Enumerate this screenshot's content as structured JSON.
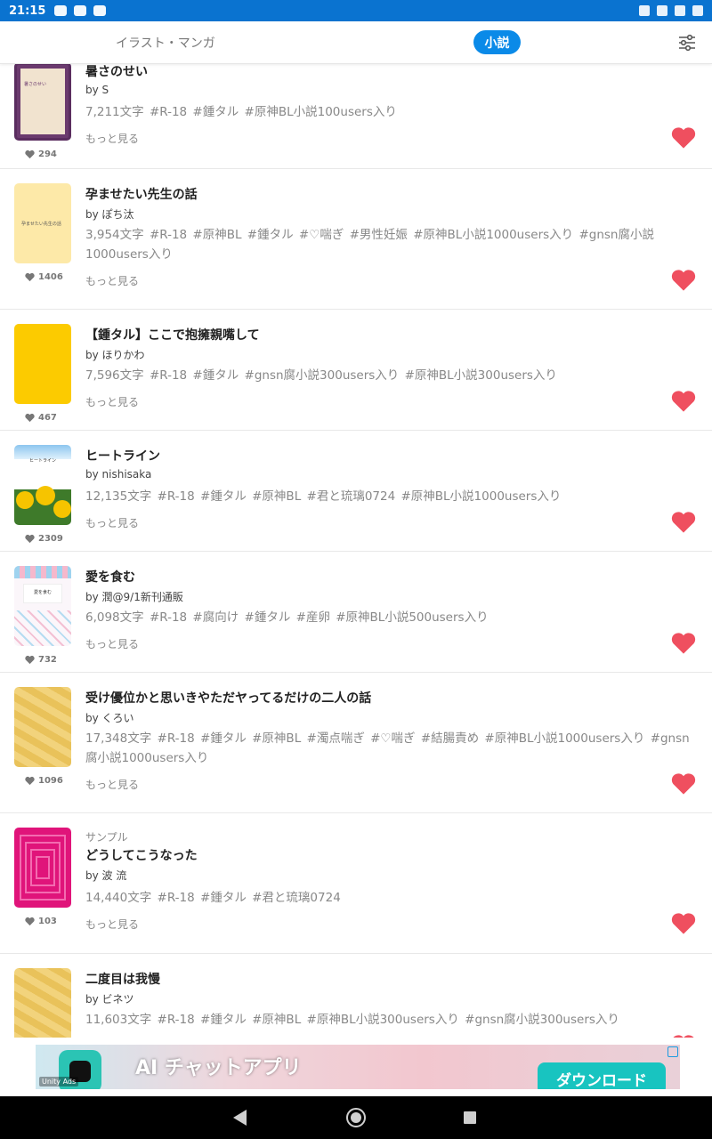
{
  "status_bar": {
    "time": "21:15"
  },
  "tabs": {
    "illust_manga": "イラスト・マンガ",
    "novel": "小説"
  },
  "colors": {
    "accent": "#0a8ae8",
    "status_bar": "#0a73d0",
    "heart": "#ef4f5f"
  },
  "feed": [
    {
      "title": "暑さのせい",
      "sample": "",
      "author": "by S",
      "tags": "7,211文字  #R-18  #鍾タル  #原神BL小説100users入り",
      "more": "もっと見る",
      "likes": "294",
      "cover_title": "暑さのせい"
    },
    {
      "title": "孕ませたい先生の話",
      "sample": "",
      "author": "by ぽち汰",
      "tags": "3,954文字  #R-18  #原神BL  #鍾タル  #♡喘ぎ  #男性妊娠  #原神BL小説1000users入り  #gnsn腐小説1000users入り",
      "more": "もっと見る",
      "likes": "1406",
      "cover_title": "孕ませたい先生の話"
    },
    {
      "title": "【鍾タル】ここで抱擁親嘴して",
      "sample": "",
      "author": "by ほりかわ",
      "tags": "7,596文字  #R-18  #鍾タル  #gnsn腐小説300users入り  #原神BL小説300users入り",
      "more": "もっと見る",
      "likes": "467",
      "cover_title": ""
    },
    {
      "title": "ヒートライン",
      "sample": "",
      "author": "by nishisaka",
      "tags": "12,135文字  #R-18  #鍾タル  #原神BL  #君と琉璃0724  #原神BL小説1000users入り",
      "more": "もっと見る",
      "likes": "2309",
      "cover_title": "ヒートライン"
    },
    {
      "title": "愛を食む",
      "sample": "",
      "author": "by 潤@9/1新刊通販",
      "tags": "6,098文字  #R-18  #腐向け  #鍾タル  #産卵  #原神BL小説500users入り",
      "more": "もっと見る",
      "likes": "732",
      "cover_title": "愛を食む"
    },
    {
      "title": "受け優位かと思いきやただヤってるだけの二人の話",
      "sample": "",
      "author": "by くろい",
      "tags": "17,348文字  #R-18  #鍾タル  #原神BL  #濁点喘ぎ  #♡喘ぎ  #結腸責め  #原神BL小説1000users入り  #gnsn腐小説1000users入り",
      "more": "もっと見る",
      "likes": "1096",
      "cover_title": ""
    },
    {
      "title": "どうしてこうなった",
      "sample": "サンプル",
      "author": "by 波 流",
      "tags": "14,440文字  #R-18  #鍾タル  #君と琉璃0724",
      "more": "もっと見る",
      "likes": "103",
      "cover_title": ""
    },
    {
      "title": "二度目は我慢",
      "sample": "",
      "author": "by ビネツ",
      "tags": "11,603文字  #R-18  #鍾タル  #原神BL  #原神BL小説300users入り  #gnsn腐小説300users入り",
      "more": "",
      "likes": "",
      "cover_title": ""
    }
  ],
  "ad": {
    "headline": "AI チャットアプリ",
    "cta": "ダウンロード",
    "brand": "Unity Ads"
  }
}
